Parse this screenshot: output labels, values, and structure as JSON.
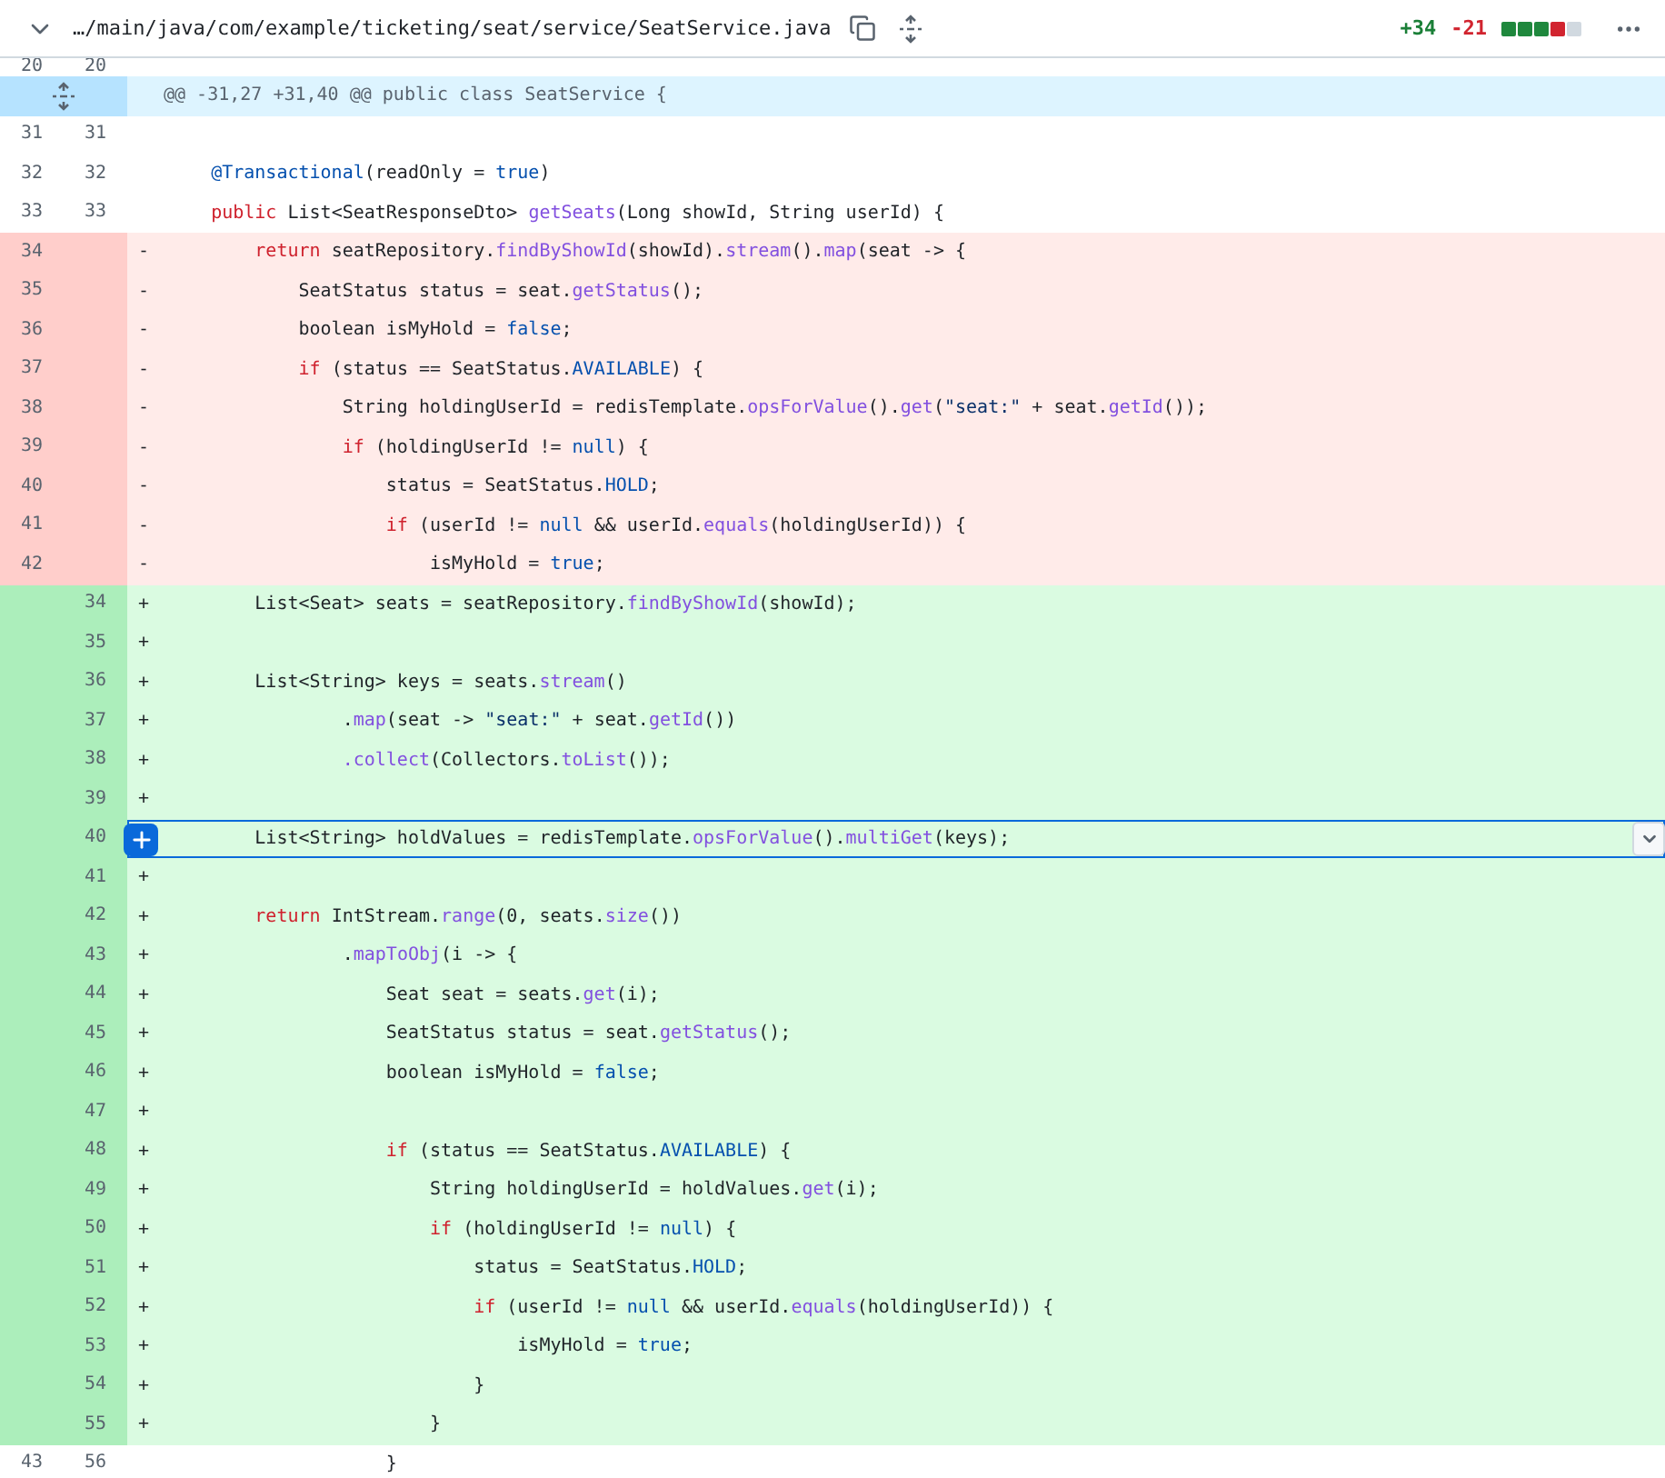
{
  "file_header": {
    "expanded": true,
    "path": "…/main/java/com/example/ticketing/seat/service/SeatService.java",
    "additions": "+34",
    "deletions": "-21",
    "diffstat": [
      {
        "kind": "add"
      },
      {
        "kind": "add"
      },
      {
        "kind": "add"
      },
      {
        "kind": "del"
      },
      {
        "kind": "neutral"
      }
    ]
  },
  "diff": {
    "hunk": "@@ -31,27 +31,40 @@ public class SeatService {",
    "lines_before_hunk": [
      {
        "kind": "context",
        "old": "20",
        "new": "20"
      }
    ],
    "lines": [
      {
        "kind": "context",
        "old": "31",
        "new": "31"
      },
      {
        "kind": "context",
        "old": "32",
        "new": "32",
        "tokens": [
          {
            "text": "    @Transactional",
            "kind": "constant"
          },
          {
            "text": "(readOnly = ",
            "kind": "plain"
          },
          {
            "text": "true",
            "kind": "constant"
          },
          {
            "text": ")",
            "kind": "plain"
          }
        ]
      },
      {
        "kind": "context",
        "old": "33",
        "new": "33",
        "tokens": [
          {
            "text": "    public",
            "kind": "keyword"
          },
          {
            "text": " List<SeatResponseDto> ",
            "kind": "plain"
          },
          {
            "text": "getSeats",
            "kind": "function"
          },
          {
            "text": "(Long showId, String userId) {",
            "kind": "plain"
          }
        ]
      },
      {
        "kind": "del",
        "old": "34",
        "sign": "-",
        "tokens": [
          {
            "text": "        return",
            "kind": "keyword"
          },
          {
            "text": " seatRepository.",
            "kind": "plain"
          },
          {
            "text": "findByShowId",
            "kind": "function"
          },
          {
            "text": "(showId).",
            "kind": "plain"
          },
          {
            "text": "stream",
            "kind": "function"
          },
          {
            "text": "().",
            "kind": "plain"
          },
          {
            "text": "map",
            "kind": "function"
          },
          {
            "text": "(seat -> {",
            "kind": "plain"
          }
        ]
      },
      {
        "kind": "del",
        "old": "35",
        "sign": "-",
        "tokens": [
          {
            "text": "            SeatStatus status = seat.",
            "kind": "plain"
          },
          {
            "text": "getStatus",
            "kind": "function"
          },
          {
            "text": "();",
            "kind": "plain"
          }
        ]
      },
      {
        "kind": "del",
        "old": "36",
        "sign": "-",
        "tokens": [
          {
            "text": "            boolean isMyHold = ",
            "kind": "plain"
          },
          {
            "text": "false",
            "kind": "constant"
          },
          {
            "text": ";",
            "kind": "plain"
          }
        ]
      },
      {
        "kind": "del",
        "old": "37",
        "sign": "-",
        "tokens": [
          {
            "text": "            if",
            "kind": "keyword"
          },
          {
            "text": " (status == SeatStatus.",
            "kind": "plain"
          },
          {
            "text": "AVAILABLE",
            "kind": "constant"
          },
          {
            "text": ") {",
            "kind": "plain"
          }
        ]
      },
      {
        "kind": "del",
        "old": "38",
        "sign": "-",
        "tokens": [
          {
            "text": "                String holdingUserId = redisTemplate.",
            "kind": "plain"
          },
          {
            "text": "opsForValue",
            "kind": "function"
          },
          {
            "text": "().",
            "kind": "plain"
          },
          {
            "text": "get",
            "kind": "function"
          },
          {
            "text": "(",
            "kind": "plain"
          },
          {
            "text": "\"seat:\"",
            "kind": "string"
          },
          {
            "text": " + seat.",
            "kind": "plain"
          },
          {
            "text": "getId",
            "kind": "function"
          },
          {
            "text": "());",
            "kind": "plain"
          }
        ]
      },
      {
        "kind": "del",
        "old": "39",
        "sign": "-",
        "tokens": [
          {
            "text": "                if",
            "kind": "keyword"
          },
          {
            "text": " (holdingUserId != ",
            "kind": "plain"
          },
          {
            "text": "null",
            "kind": "constant"
          },
          {
            "text": ") {",
            "kind": "plain"
          }
        ]
      },
      {
        "kind": "del",
        "old": "40",
        "sign": "-",
        "tokens": [
          {
            "text": "                    status = SeatStatus.",
            "kind": "plain"
          },
          {
            "text": "HOLD",
            "kind": "constant"
          },
          {
            "text": ";",
            "kind": "plain"
          }
        ]
      },
      {
        "kind": "del",
        "old": "41",
        "sign": "-",
        "tokens": [
          {
            "text": "                    if",
            "kind": "keyword"
          },
          {
            "text": " (userId != ",
            "kind": "plain"
          },
          {
            "text": "null",
            "kind": "constant"
          },
          {
            "text": " && userId.",
            "kind": "plain"
          },
          {
            "text": "equals",
            "kind": "function"
          },
          {
            "text": "(holdingUserId)) {",
            "kind": "plain"
          }
        ]
      },
      {
        "kind": "del",
        "old": "42",
        "sign": "-",
        "tokens": [
          {
            "text": "                        isMyHold = ",
            "kind": "plain"
          },
          {
            "text": "true",
            "kind": "constant"
          },
          {
            "text": ";",
            "kind": "plain"
          }
        ]
      },
      {
        "kind": "add",
        "new": "34",
        "sign": "+",
        "focused": false,
        "tokens": [
          {
            "text": "        List<Seat> seats = seatRepository.",
            "kind": "plain"
          },
          {
            "text": "findByShowId",
            "kind": "function"
          },
          {
            "text": "(showId);",
            "kind": "plain"
          }
        ]
      },
      {
        "kind": "add",
        "new": "35",
        "sign": "+",
        "focused": false
      },
      {
        "kind": "add",
        "new": "36",
        "sign": "+",
        "focused": false,
        "tokens": [
          {
            "text": "        List<String> keys = seats.",
            "kind": "plain"
          },
          {
            "text": "stream",
            "kind": "function"
          },
          {
            "text": "()",
            "kind": "plain"
          }
        ]
      },
      {
        "kind": "add",
        "new": "37",
        "sign": "+",
        "focused": false,
        "tokens": [
          {
            "text": "                .",
            "kind": "plain"
          },
          {
            "text": "map",
            "kind": "function"
          },
          {
            "text": "(seat -> ",
            "kind": "plain"
          },
          {
            "text": "\"seat:\"",
            "kind": "string"
          },
          {
            "text": " + seat.",
            "kind": "plain"
          },
          {
            "text": "getId",
            "kind": "function"
          },
          {
            "text": "())",
            "kind": "plain"
          }
        ]
      },
      {
        "kind": "add",
        "new": "38",
        "sign": "+",
        "focused": false,
        "tokens": [
          {
            "text": "                .collect",
            "kind": "function"
          },
          {
            "text": "(Collectors.",
            "kind": "plain"
          },
          {
            "text": "toList",
            "kind": "function"
          },
          {
            "text": "());",
            "kind": "plain"
          }
        ]
      },
      {
        "kind": "add",
        "new": "39",
        "sign": "+",
        "focused": false
      },
      {
        "kind": "add",
        "new": "40",
        "focused": true,
        "tokens": [
          {
            "text": "        List<String> holdValues = redisTemplate.",
            "kind": "plain"
          },
          {
            "text": "opsForValue",
            "kind": "function"
          },
          {
            "text": "().",
            "kind": "plain"
          },
          {
            "text": "multiGet",
            "kind": "function"
          },
          {
            "text": "(keys);",
            "kind": "plain"
          }
        ]
      },
      {
        "kind": "add",
        "new": "41",
        "sign": "+",
        "focused": false
      },
      {
        "kind": "add",
        "new": "42",
        "sign": "+",
        "focused": false,
        "tokens": [
          {
            "text": "        return",
            "kind": "keyword"
          },
          {
            "text": " IntStream.",
            "kind": "plain"
          },
          {
            "text": "range",
            "kind": "function"
          },
          {
            "text": "(0, seats.",
            "kind": "plain"
          },
          {
            "text": "size",
            "kind": "function"
          },
          {
            "text": "())",
            "kind": "plain"
          }
        ]
      },
      {
        "kind": "add",
        "new": "43",
        "sign": "+",
        "focused": false,
        "tokens": [
          {
            "text": "                .",
            "kind": "plain"
          },
          {
            "text": "mapToObj",
            "kind": "function"
          },
          {
            "text": "(i -> {",
            "kind": "plain"
          }
        ]
      },
      {
        "kind": "add",
        "new": "44",
        "sign": "+",
        "focused": false,
        "tokens": [
          {
            "text": "                    Seat seat = seats.",
            "kind": "plain"
          },
          {
            "text": "get",
            "kind": "function"
          },
          {
            "text": "(i);",
            "kind": "plain"
          }
        ]
      },
      {
        "kind": "add",
        "new": "45",
        "sign": "+",
        "focused": false,
        "tokens": [
          {
            "text": "                    SeatStatus status = seat.",
            "kind": "plain"
          },
          {
            "text": "getStatus",
            "kind": "function"
          },
          {
            "text": "();",
            "kind": "plain"
          }
        ]
      },
      {
        "kind": "add",
        "new": "46",
        "sign": "+",
        "focused": false,
        "tokens": [
          {
            "text": "                    boolean isMyHold = ",
            "kind": "plain"
          },
          {
            "text": "false",
            "kind": "constant"
          },
          {
            "text": ";",
            "kind": "plain"
          }
        ]
      },
      {
        "kind": "add",
        "new": "47",
        "sign": "+",
        "focused": false
      },
      {
        "kind": "add",
        "new": "48",
        "sign": "+",
        "focused": false,
        "tokens": [
          {
            "text": "                    if",
            "kind": "keyword"
          },
          {
            "text": " (status == SeatStatus.",
            "kind": "plain"
          },
          {
            "text": "AVAILABLE",
            "kind": "constant"
          },
          {
            "text": ") {",
            "kind": "plain"
          }
        ]
      },
      {
        "kind": "add",
        "new": "49",
        "sign": "+",
        "focused": false,
        "tokens": [
          {
            "text": "                        String holdingUserId = holdValues.",
            "kind": "plain"
          },
          {
            "text": "get",
            "kind": "function"
          },
          {
            "text": "(i);",
            "kind": "plain"
          }
        ]
      },
      {
        "kind": "add",
        "new": "50",
        "sign": "+",
        "focused": false,
        "tokens": [
          {
            "text": "                        if",
            "kind": "keyword"
          },
          {
            "text": " (holdingUserId != ",
            "kind": "plain"
          },
          {
            "text": "null",
            "kind": "constant"
          },
          {
            "text": ") {",
            "kind": "plain"
          }
        ]
      },
      {
        "kind": "add",
        "new": "51",
        "sign": "+",
        "focused": false,
        "tokens": [
          {
            "text": "                            status = SeatStatus.",
            "kind": "plain"
          },
          {
            "text": "HOLD",
            "kind": "constant"
          },
          {
            "text": ";",
            "kind": "plain"
          }
        ]
      },
      {
        "kind": "add",
        "new": "52",
        "sign": "+",
        "focused": false,
        "tokens": [
          {
            "text": "                            if",
            "kind": "keyword"
          },
          {
            "text": " (userId != ",
            "kind": "plain"
          },
          {
            "text": "null",
            "kind": "constant"
          },
          {
            "text": " && userId.",
            "kind": "plain"
          },
          {
            "text": "equals",
            "kind": "function"
          },
          {
            "text": "(holdingUserId)) {",
            "kind": "plain"
          }
        ]
      },
      {
        "kind": "add",
        "new": "53",
        "sign": "+",
        "focused": false,
        "tokens": [
          {
            "text": "                                isMyHold = ",
            "kind": "plain"
          },
          {
            "text": "true",
            "kind": "constant"
          },
          {
            "text": ";",
            "kind": "plain"
          }
        ]
      },
      {
        "kind": "add",
        "new": "54",
        "sign": "+",
        "focused": false,
        "tokens": [
          {
            "text": "                            }",
            "kind": "plain"
          }
        ]
      },
      {
        "kind": "add",
        "new": "55",
        "sign": "+",
        "focused": false,
        "tokens": [
          {
            "text": "                        }",
            "kind": "plain"
          }
        ]
      },
      {
        "kind": "context",
        "old": "43",
        "new": "56",
        "tokens": [
          {
            "text": "                    }",
            "kind": "plain"
          }
        ]
      }
    ]
  }
}
